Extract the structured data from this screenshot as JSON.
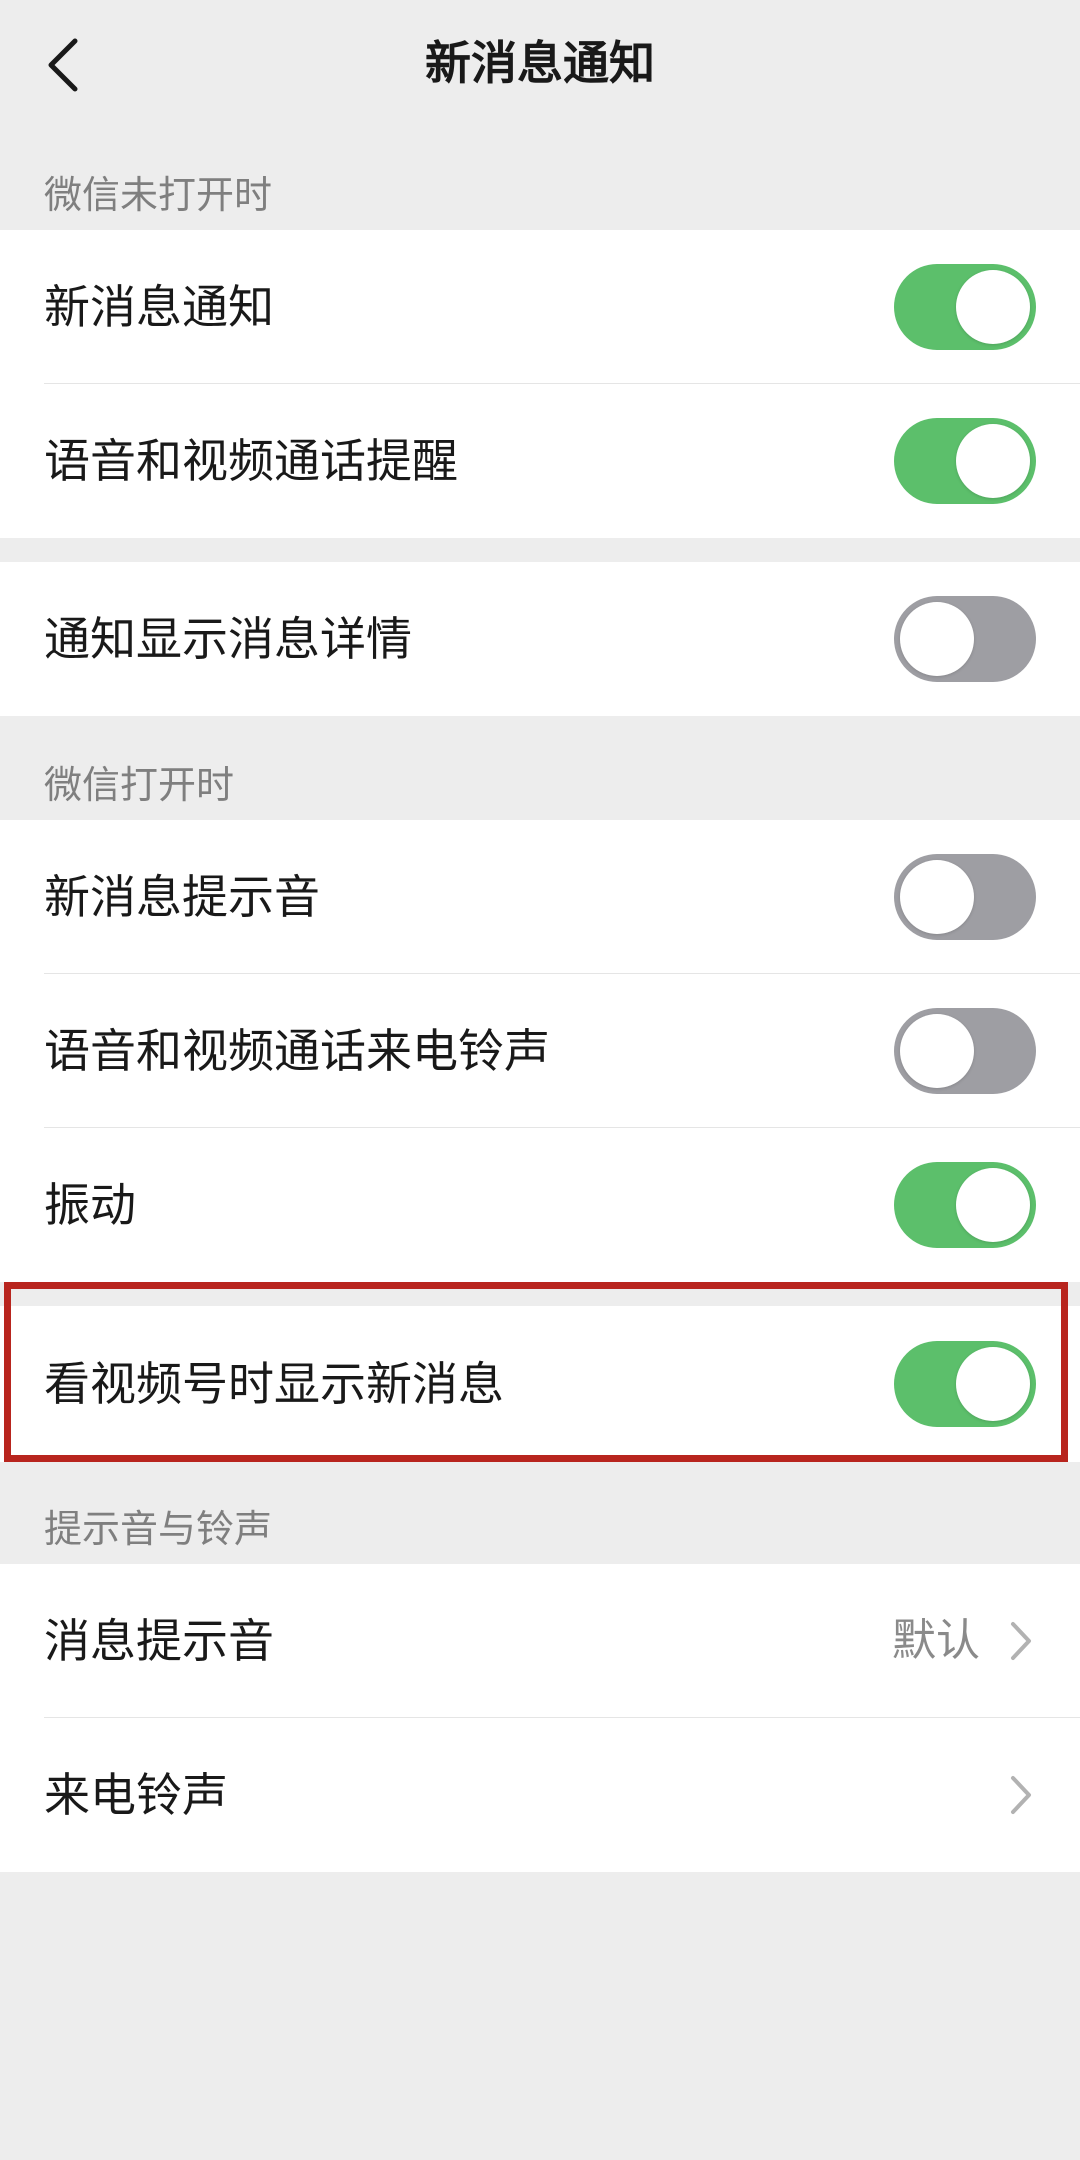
{
  "nav": {
    "title": "新消息通知",
    "back_icon": "chevron-left-icon"
  },
  "sections": [
    {
      "label": "微信未打开时"
    },
    {
      "label": "微信打开时"
    },
    {
      "label": "提示音与铃声"
    }
  ],
  "group1": [
    {
      "label": "新消息通知",
      "on": true
    },
    {
      "label": "语音和视频通话提醒",
      "on": true
    }
  ],
  "group2": [
    {
      "label": "通知显示消息详情",
      "on": false
    }
  ],
  "group3": [
    {
      "label": "新消息提示音",
      "on": false
    },
    {
      "label": "语音和视频通话来电铃声",
      "on": false
    },
    {
      "label": "振动",
      "on": true
    }
  ],
  "group4": [
    {
      "label": "看视频号时显示新消息",
      "on": true
    }
  ],
  "group5": [
    {
      "label": "消息提示音",
      "value": "默认",
      "icon": "chevron-right-icon"
    },
    {
      "label": "来电铃声",
      "value": "",
      "icon": "chevron-right-icon"
    }
  ],
  "colors": {
    "switch_on": "#5cbf6b",
    "switch_off": "#9e9ea3",
    "highlight": "#b8251e",
    "background": "#ededed"
  }
}
